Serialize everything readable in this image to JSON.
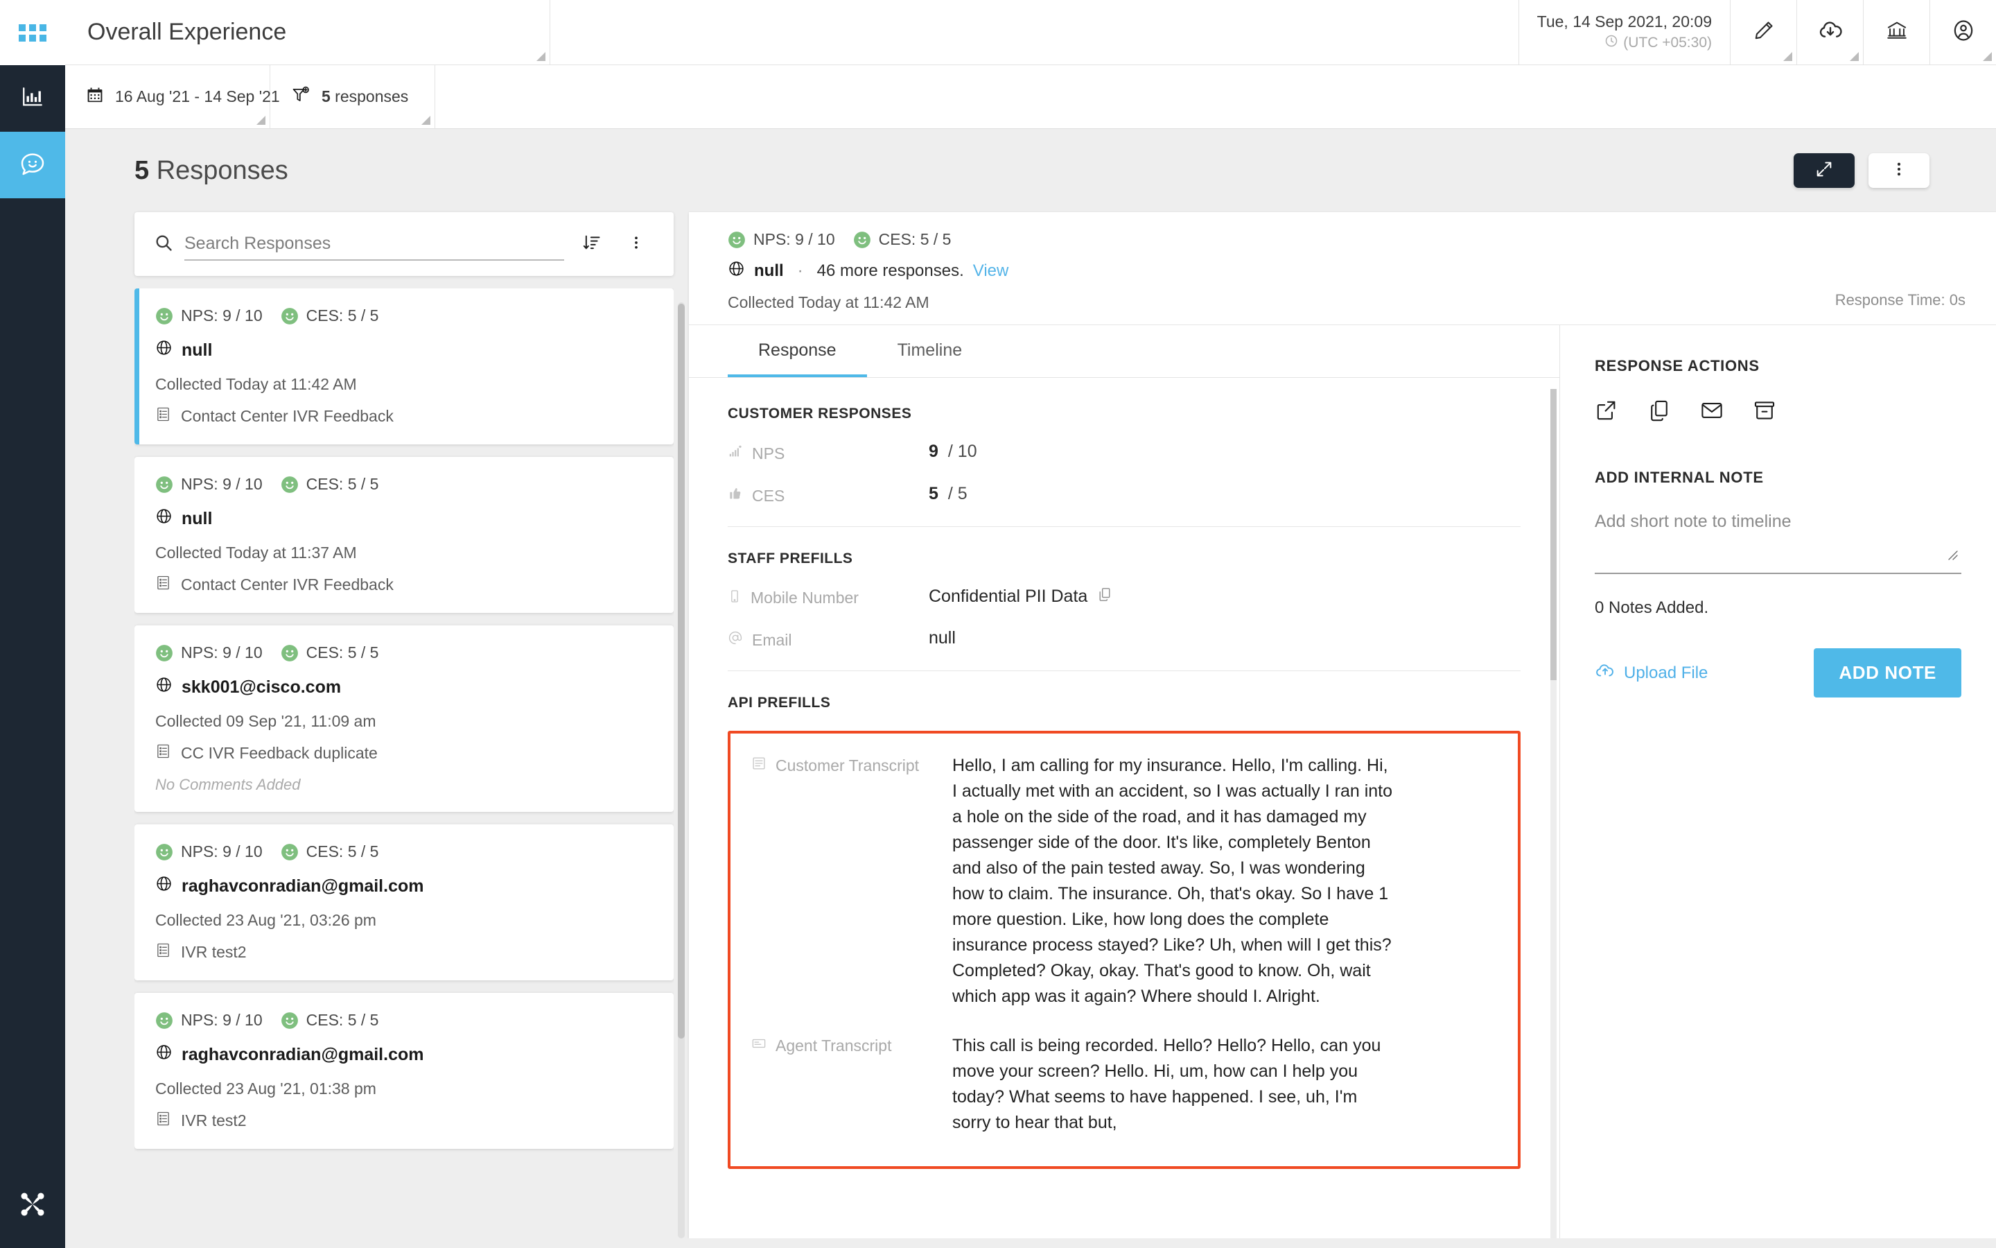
{
  "rail": {
    "apps_icon": "grid-apps-icon",
    "items": [
      {
        "icon": "bar-chart-icon",
        "name": "analytics",
        "active": false
      },
      {
        "icon": "chat-smiley-icon",
        "name": "responses",
        "active": true
      }
    ],
    "logo": "brand-star-logo"
  },
  "header": {
    "title": "Overall Experience",
    "timestamp": "Tue, 14 Sep 2021, 20:09",
    "timezone": "(UTC +05:30)",
    "clock_icon": "clock-icon",
    "actions": [
      {
        "icon": "pencil-edit-icon",
        "name": "edit-survey"
      },
      {
        "icon": "cloud-download-icon",
        "name": "download"
      },
      {
        "icon": "bank-institution-icon",
        "name": "organization"
      },
      {
        "icon": "user-account-icon",
        "name": "account"
      }
    ]
  },
  "filters": [
    {
      "icon": "calendar-icon",
      "label": "16 Aug '21 - 14 Sep '21",
      "name": "date-range-filter"
    },
    {
      "icon": "filter-plus-icon",
      "count": "5",
      "label": " responses",
      "name": "response-filter"
    }
  ],
  "content_head": {
    "count": "5",
    "label": " Responses",
    "expand_icon": "expand-diagonal-icon",
    "more_icon": "more-vertical-icon"
  },
  "search": {
    "placeholder": "Search Responses",
    "value": "",
    "search_icon": "search-icon",
    "sort_icon": "sort-descending-icon",
    "more_icon": "more-vertical-icon"
  },
  "responses": [
    {
      "nps": "NPS: 9 / 10",
      "ces": "CES: 5 / 5",
      "identifier": "null",
      "collected": "Collected Today at 11:42 AM",
      "source": "Contact Center IVR Feedback",
      "comment": "",
      "selected": true
    },
    {
      "nps": "NPS: 9 / 10",
      "ces": "CES: 5 / 5",
      "identifier": "null",
      "collected": "Collected Today at 11:37 AM",
      "source": "Contact Center IVR Feedback",
      "comment": "",
      "selected": false
    },
    {
      "nps": "NPS: 9 / 10",
      "ces": "CES: 5 / 5",
      "identifier": "skk001@cisco.com",
      "collected": "Collected 09 Sep '21, 11:09 am",
      "source": "CC IVR Feedback duplicate",
      "comment": "No Comments Added",
      "selected": false
    },
    {
      "nps": "NPS: 9 / 10",
      "ces": "CES: 5 / 5",
      "identifier": "raghavconradian@gmail.com",
      "collected": "Collected 23 Aug '21, 03:26 pm",
      "source": "IVR test2",
      "comment": "",
      "selected": false
    },
    {
      "nps": "NPS: 9 / 10",
      "ces": "CES: 5 / 5",
      "identifier": "raghavconradian@gmail.com",
      "collected": "Collected 23 Aug '21, 01:38 pm",
      "source": "IVR test2",
      "comment": "",
      "selected": false
    }
  ],
  "detail": {
    "nps": "NPS: 9 / 10",
    "ces": "CES: 5 / 5",
    "identifier": "null",
    "separator": "·",
    "more_responses": "46 more responses.",
    "view_link": "View",
    "collected": "Collected Today at 11:42 AM",
    "response_time": "Response Time: 0s",
    "tabs": [
      {
        "label": "Response",
        "active": true
      },
      {
        "label": "Timeline",
        "active": false
      }
    ],
    "customer_responses": {
      "title": "CUSTOMER RESPONSES",
      "rows": [
        {
          "icon": "signal-bars-icon",
          "label": "NPS",
          "value": "9",
          "denominator": "/ 10"
        },
        {
          "icon": "thumbs-up-icon",
          "label": "CES",
          "value": "5",
          "denominator": "/ 5"
        }
      ]
    },
    "staff_prefills": {
      "title": "STAFF PREFILLS",
      "rows": [
        {
          "icon": "mobile-phone-icon",
          "label": "Mobile Number",
          "value": "Confidential PII Data",
          "copy_icon": "copy-icon"
        },
        {
          "icon": "at-sign-icon",
          "label": "Email",
          "value": "null",
          "copy_icon": ""
        }
      ]
    },
    "api_prefills": {
      "title": "API PREFILLS",
      "highlight_color": "#f04a23",
      "rows": [
        {
          "icon": "transcript-lines-icon",
          "label": "Customer Transcript",
          "value": "Hello, I am calling for my insurance. Hello, I'm calling. Hi, I actually met with an accident, so I was actually I ran into a hole on the side of the road, and it has damaged my passenger side of the door. It's like, completely Benton and also of the pain tested away. So, I was wondering how to claim. The insurance. Oh, that's okay. So I have 1 more question. Like, how long does the complete insurance process stayed? Like? Uh, when will I get this? Completed? Okay, okay. That's good to know. Oh, wait which app was it again? Where should I. Alright."
        },
        {
          "icon": "transcript-box-icon",
          "label": "Agent Transcript",
          "value": "This call is being recorded. Hello? Hello? Hello, can you move your screen? Hello. Hi, um, how can I help you today? What seems to have happened. I see, uh, I'm sorry to hear that but,"
        }
      ]
    }
  },
  "actions": {
    "title": "RESPONSE ACTIONS",
    "icons": [
      {
        "icon": "external-link-icon",
        "name": "open-external"
      },
      {
        "icon": "copy-icon",
        "name": "copy-response"
      },
      {
        "icon": "envelope-icon",
        "name": "email-response"
      },
      {
        "icon": "archive-box-icon",
        "name": "archive-response"
      }
    ],
    "note_title": "ADD INTERNAL NOTE",
    "note_placeholder": "Add short note to timeline",
    "note_value": "",
    "notes_count": "0 Notes Added.",
    "upload_label": "Upload File",
    "upload_icon": "cloud-upload-icon",
    "add_note_label": "ADD NOTE"
  },
  "colors": {
    "accent": "#4fb9e8",
    "dark": "#1d2733",
    "smiley_green": "#7fbf7f",
    "highlight_red": "#f04a23",
    "link": "#54b4e8"
  }
}
